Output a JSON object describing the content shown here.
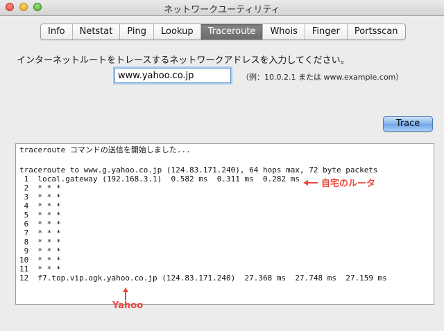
{
  "window": {
    "title": "ネットワークユーティリティ"
  },
  "tabs": [
    {
      "label": "Info"
    },
    {
      "label": "Netstat"
    },
    {
      "label": "Ping"
    },
    {
      "label": "Lookup"
    },
    {
      "label": "Traceroute",
      "active": true
    },
    {
      "label": "Whois"
    },
    {
      "label": "Finger"
    },
    {
      "label": "Portsscan"
    }
  ],
  "form": {
    "prompt": "インターネットルートをトレースするネットワークアドレスを入力してください。",
    "host_value": "www.yahoo.co.jp",
    "example": "（例：10.0.2.1 または www.example.com）",
    "trace_label": "Trace"
  },
  "output": {
    "lines": [
      "traceroute コマンドの送信を開始しました...",
      "",
      "traceroute to www.g.yahoo.co.jp (124.83.171.240), 64 hops max, 72 byte packets",
      " 1  local.gateway (192.168.3.1)  0.582 ms  0.311 ms  0.282 ms",
      " 2  * * *",
      " 3  * * *",
      " 4  * * *",
      " 5  * * *",
      " 6  * * *",
      " 7  * * *",
      " 8  * * *",
      " 9  * * *",
      "10  * * *",
      "11  * * *",
      "12  f7.top.vip.ogk.yahoo.co.jp (124.83.171.240)  27.368 ms  27.748 ms  27.159 ms"
    ]
  },
  "annotations": {
    "router_label": "自宅のルータ",
    "yahoo_label": "Yahoo",
    "color": "#f0443a"
  }
}
